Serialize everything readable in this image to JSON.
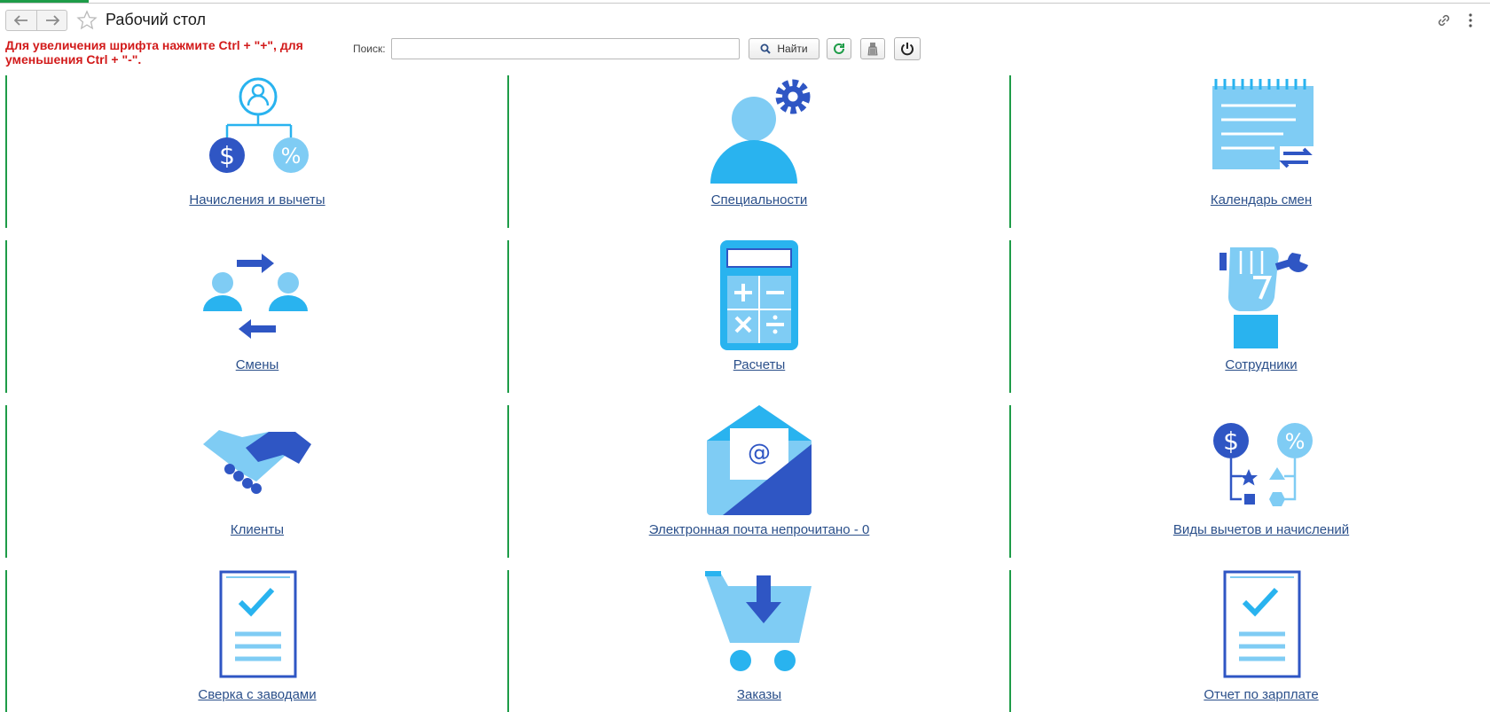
{
  "window": {
    "title": "Рабочий стол",
    "hint": "Для увеличения шрифта нажмите Ctrl + \"+\", для уменьшения Ctrl + \"-\"."
  },
  "search": {
    "label": "Поиск:",
    "value": "",
    "find_label": "Найти"
  },
  "tiles": [
    {
      "label": "Начисления и вычеты",
      "icon": "accruals-icon"
    },
    {
      "label": "Специальности",
      "icon": "specialties-icon"
    },
    {
      "label": "Календарь смен",
      "icon": "shift-calendar-icon"
    },
    {
      "label": "Смены",
      "icon": "shifts-icon"
    },
    {
      "label": "Расчеты",
      "icon": "calculator-icon"
    },
    {
      "label": "Сотрудники",
      "icon": "employees-icon"
    },
    {
      "label": "Клиенты",
      "icon": "handshake-icon"
    },
    {
      "label": "Электронная почта непрочитано - 0",
      "icon": "email-icon"
    },
    {
      "label": "Виды вычетов и начислений",
      "icon": "deduction-types-icon"
    },
    {
      "label": "Сверка с заводами",
      "icon": "checklist-icon"
    },
    {
      "label": "Заказы",
      "icon": "cart-icon"
    },
    {
      "label": "Отчет по зарплате",
      "icon": "report-icon"
    }
  ],
  "colors": {
    "accent_green": "#1e9c48",
    "hint_red": "#d21a1a",
    "icon_light": "#7fccf4",
    "icon_mid": "#29b3ef",
    "icon_dark": "#2f56c4",
    "link": "#2a4f8a"
  }
}
